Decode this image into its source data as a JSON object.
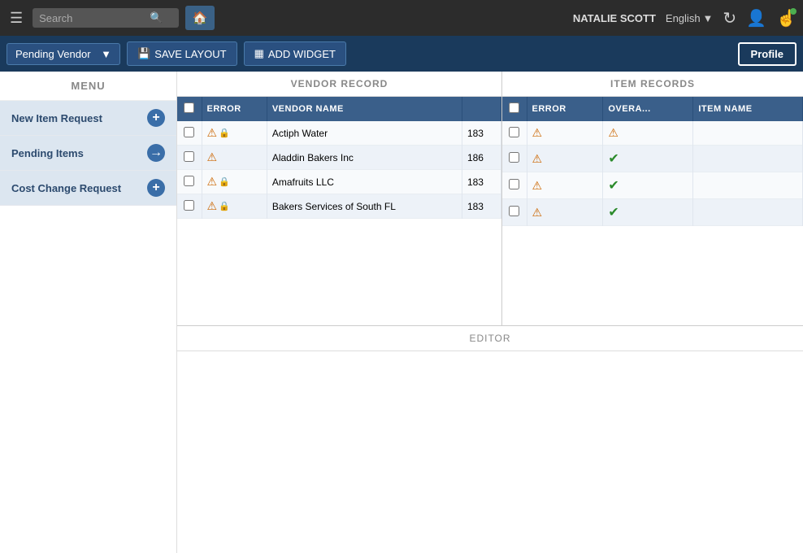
{
  "topNav": {
    "search_placeholder": "Search",
    "home_icon": "🏠",
    "hamburger_icon": "☰",
    "username": "NATALIE SCOTT",
    "language": "English",
    "chevron_icon": "▼"
  },
  "toolbar": {
    "pending_vendor_label": "Pending Vendor",
    "pending_vendor_chevron": "▼",
    "save_layout_label": "SAVE LAYOUT",
    "add_widget_label": "ADD WIDGET",
    "profile_label": "Profile",
    "save_icon": "💾",
    "widget_icon": "▦"
  },
  "menu": {
    "header": "MENU",
    "items": [
      {
        "label": "New Item Request",
        "icon": "+"
      },
      {
        "label": "Pending Items",
        "icon": "→"
      },
      {
        "label": "Cost Change Request",
        "icon": "+"
      }
    ]
  },
  "vendorRecord": {
    "header": "VENDOR RECORD",
    "columns": [
      "",
      "ERROR",
      "VENDOR NAME",
      ""
    ],
    "rows": [
      {
        "error": "warn+lock",
        "vendor_name": "Actiph Water",
        "id": "183"
      },
      {
        "error": "warn",
        "vendor_name": "Aladdin Bakers Inc",
        "id": "186"
      },
      {
        "error": "warn+lock",
        "vendor_name": "Amafruits LLC",
        "id": "183"
      },
      {
        "error": "warn+lock",
        "vendor_name": "Bakers Services of South FL",
        "id": "183"
      }
    ]
  },
  "itemRecords": {
    "header": "ITEM RECORDS",
    "columns": [
      "",
      "ERROR",
      "OVERA...",
      "ITEM NAME"
    ],
    "rows": [
      {
        "error": "warn",
        "overall": "warn",
        "item_name": ""
      },
      {
        "error": "warn",
        "overall": "check",
        "item_name": ""
      },
      {
        "error": "warn",
        "overall": "check",
        "item_name": ""
      },
      {
        "error": "warn",
        "overall": "check",
        "item_name": ""
      }
    ]
  },
  "editor": {
    "header": "EDITOR"
  }
}
